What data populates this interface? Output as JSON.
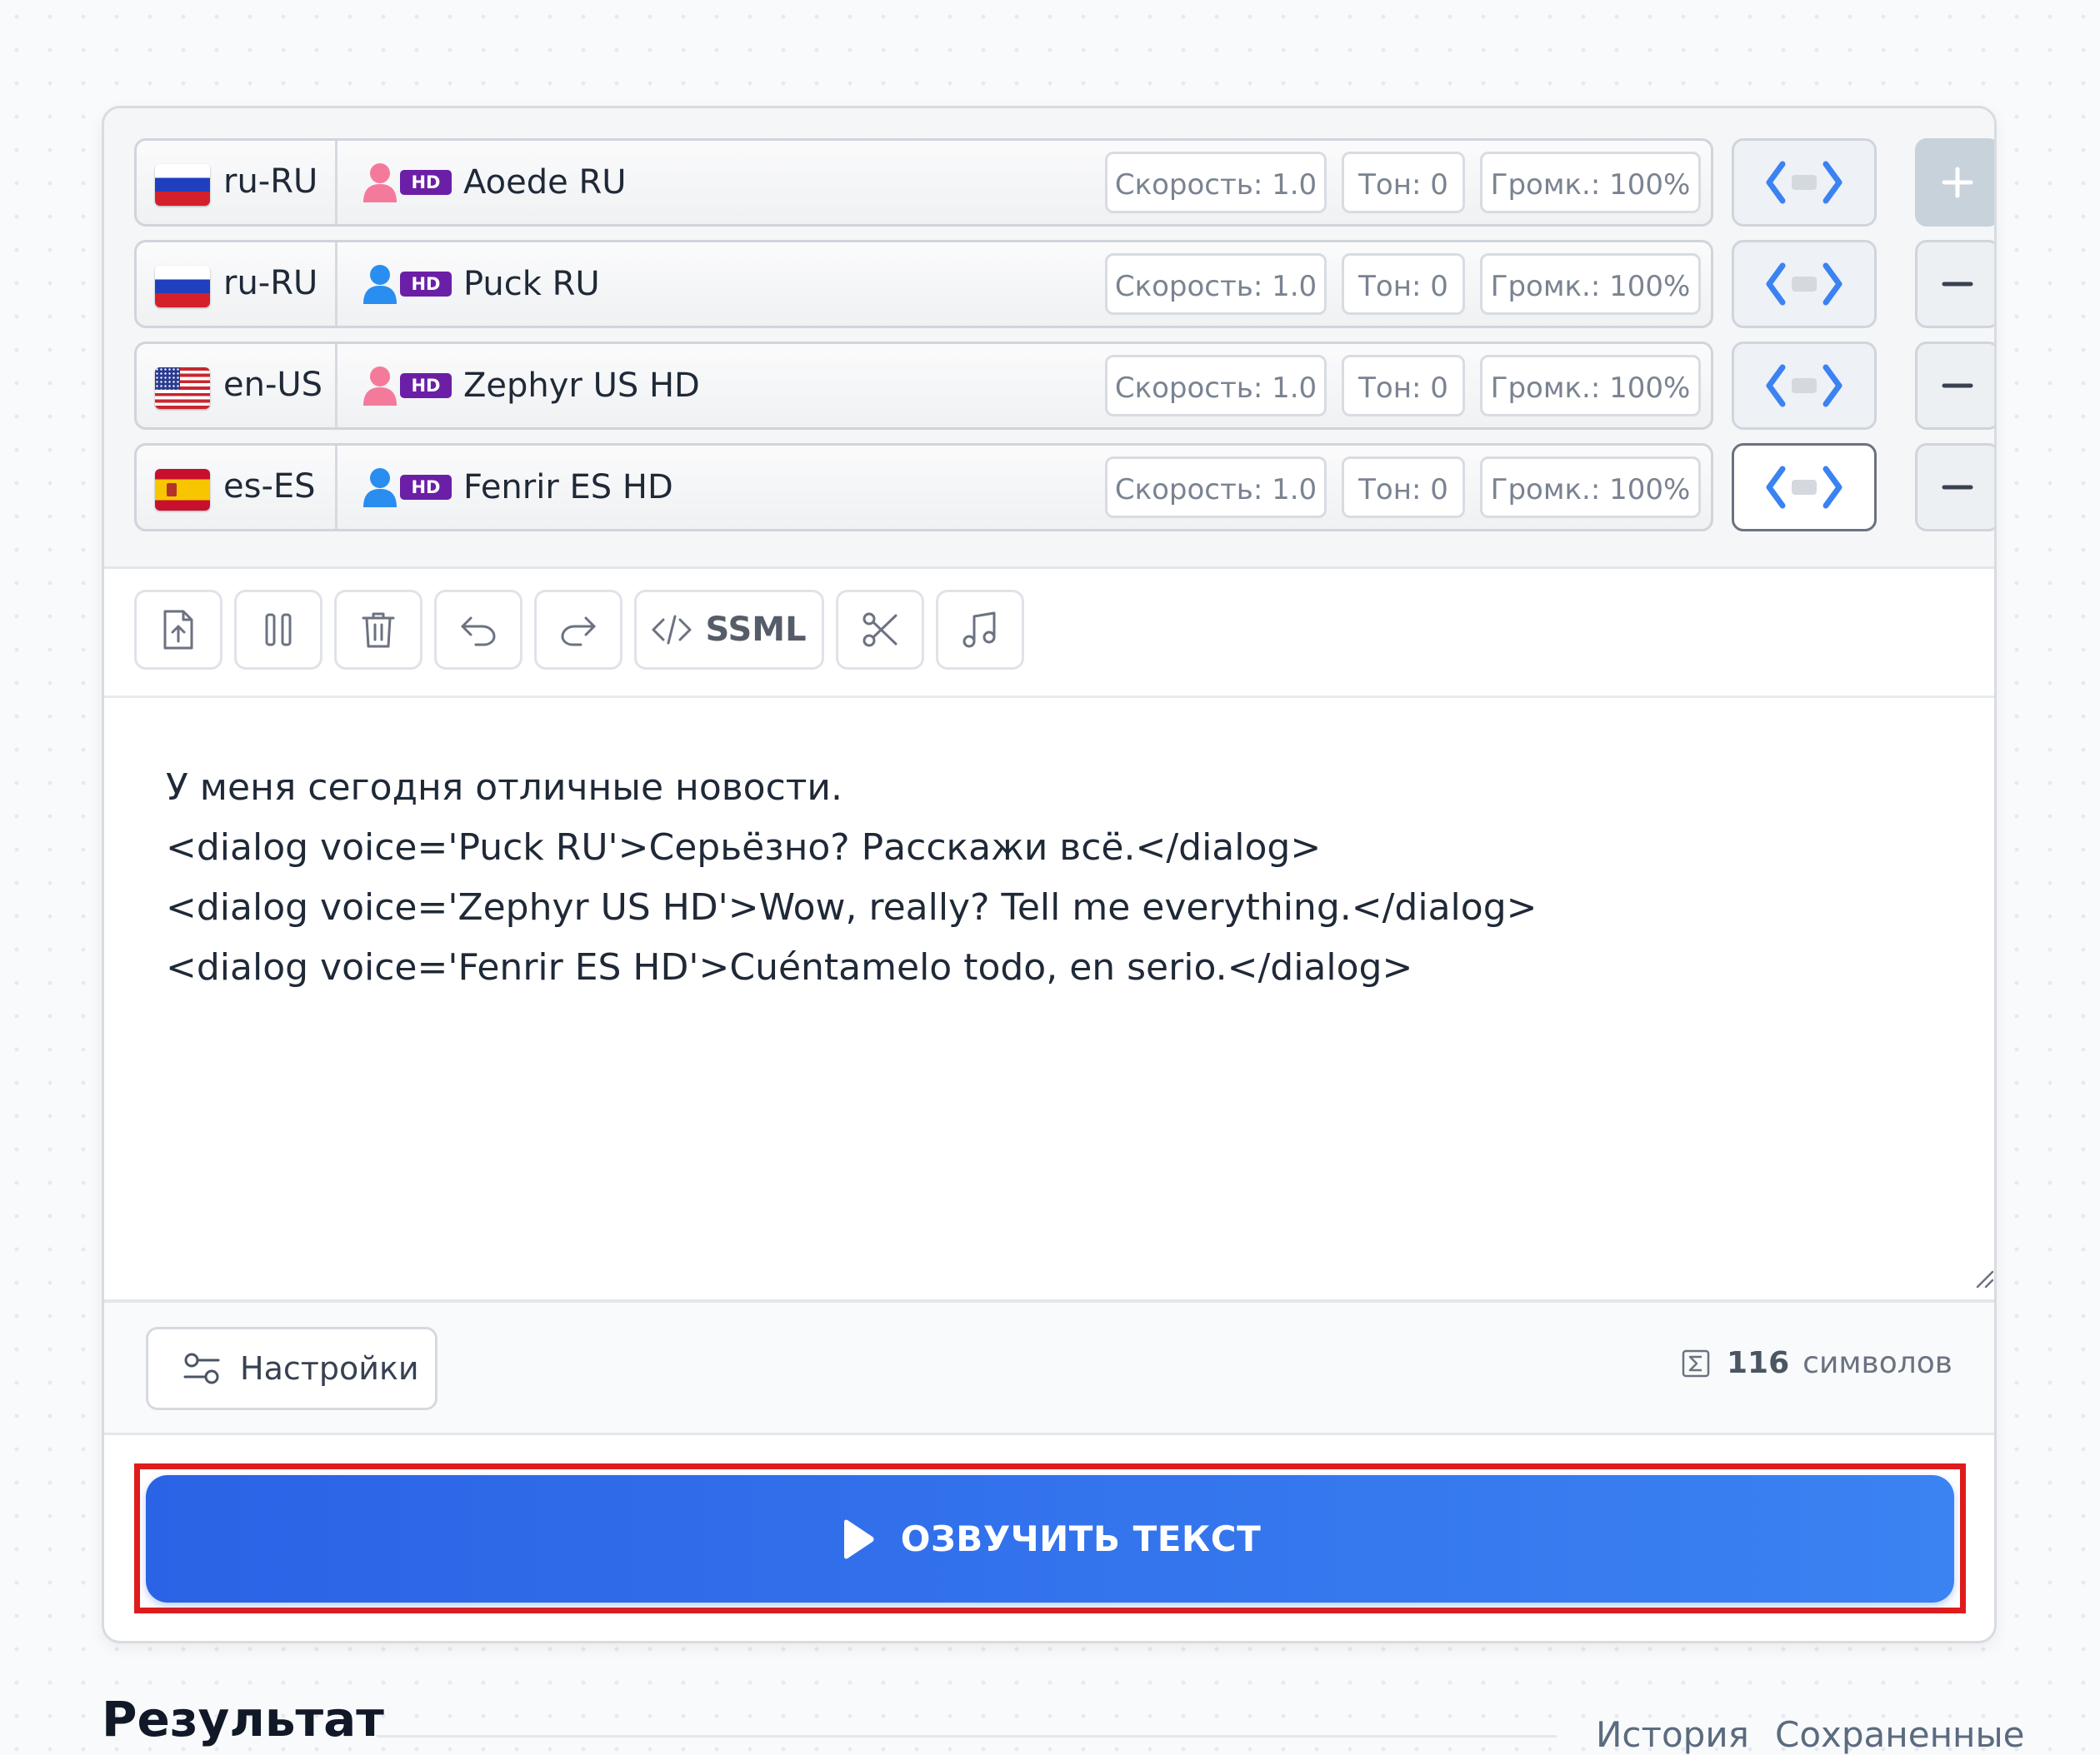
{
  "voices": [
    {
      "lang": "ru-RU",
      "flag": "ru",
      "gender": "female",
      "badge": "HD",
      "name": "Aoede RU",
      "speed": "Скорость: 1.0",
      "tone": "Тон: 0",
      "volume": "Громк.: 100%",
      "action": "+"
    },
    {
      "lang": "ru-RU",
      "flag": "ru",
      "gender": "male",
      "badge": "HD",
      "name": "Puck RU",
      "speed": "Скорость: 1.0",
      "tone": "Тон: 0",
      "volume": "Громк.: 100%",
      "action": "−"
    },
    {
      "lang": "en-US",
      "flag": "us",
      "gender": "female",
      "badge": "HD",
      "name": "Zephyr US HD",
      "speed": "Скорость: 1.0",
      "tone": "Тон: 0",
      "volume": "Громк.: 100%",
      "action": "−"
    },
    {
      "lang": "es-ES",
      "flag": "es",
      "gender": "male",
      "badge": "HD",
      "name": "Fenrir ES HD",
      "speed": "Скорость: 1.0",
      "tone": "Тон: 0",
      "volume": "Громк.: 100%",
      "action": "−"
    }
  ],
  "toolbar": {
    "ssml_label": "SSML",
    "icons": [
      "file-upload-icon",
      "pause-icon",
      "trash-icon",
      "undo-icon",
      "redo-icon",
      "code-icon",
      "scissors-icon",
      "music-note-icon"
    ]
  },
  "editor": {
    "lines": [
      "У меня сегодня отличные новости.",
      "<dialog voice='Puck RU'>Серьёзно? Расскажи всё.</dialog>",
      "<dialog voice='Zephyr US HD'>Wow, really? Tell me everything.</dialog>",
      "<dialog voice='Fenrir ES HD'>Cuéntamelo todo, en serio.</dialog>"
    ]
  },
  "footer": {
    "settings_label": "Настройки",
    "char_count": "116",
    "char_unit": "символов"
  },
  "speak_button": {
    "label": "ОЗВУЧИТЬ ТЕКСТ"
  },
  "result": {
    "title": "Результат",
    "tabs": [
      "История",
      "Сохраненные"
    ]
  },
  "colors": {
    "accent": "#2b63e6",
    "hd_badge": "#6b1fa6",
    "female_icon": "#f47a9c",
    "male_icon": "#2a8df0",
    "highlight_outline": "#e01b1b"
  }
}
